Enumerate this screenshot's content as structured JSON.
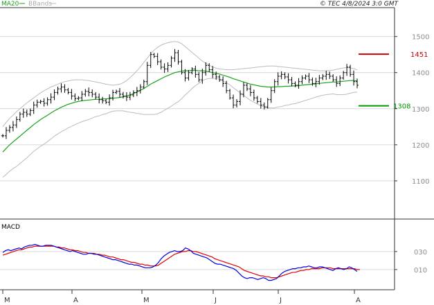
{
  "header": {
    "ma_label": "MA20",
    "bb_label": "BBands",
    "timestamp": "© TEC 4/8/2024 3:0 GMT"
  },
  "colors": {
    "ma": "#1aa21a",
    "bands": "#bbbbbb",
    "price": "#000000",
    "macd": "#0000dd",
    "signal": "#dd0000",
    "resistance": "#cc0000",
    "support": "#009900",
    "grid": "#d6d6d6",
    "frame": "#333333"
  },
  "chart_data": [
    {
      "type": "ohlc",
      "title": "",
      "ylim": [
        1000,
        1530
      ],
      "y_ticks": [
        1100,
        1200,
        1300,
        1400,
        1500
      ],
      "y_tick_labels": [
        "1100",
        "1200",
        "1300",
        "1400",
        "1500"
      ],
      "x_months": [
        "M",
        "A",
        "M",
        "J",
        "J",
        "A"
      ],
      "legend": [
        "MA20",
        "BBands"
      ],
      "reference_lines": [
        {
          "name": "resistance",
          "label": "1451",
          "value": 1451
        },
        {
          "name": "support",
          "label": "1308",
          "value": 1308
        }
      ],
      "close": [
        1225,
        1240,
        1248,
        1255,
        1270,
        1285,
        1290,
        1285,
        1295,
        1310,
        1318,
        1320,
        1315,
        1325,
        1332,
        1345,
        1355,
        1360,
        1352,
        1345,
        1335,
        1328,
        1330,
        1340,
        1348,
        1345,
        1340,
        1332,
        1325,
        1322,
        1318,
        1330,
        1345,
        1348,
        1340,
        1335,
        1332,
        1338,
        1345,
        1350,
        1360,
        1375,
        1420,
        1450,
        1445,
        1430,
        1415,
        1410,
        1420,
        1440,
        1455,
        1430,
        1400,
        1385,
        1400,
        1410,
        1395,
        1380,
        1400,
        1420,
        1408,
        1395,
        1388,
        1380,
        1370,
        1350,
        1330,
        1310,
        1320,
        1340,
        1365,
        1355,
        1345,
        1330,
        1320,
        1310,
        1305,
        1325,
        1350,
        1375,
        1390,
        1395,
        1388,
        1380,
        1370,
        1365,
        1375,
        1385,
        1390,
        1380,
        1370,
        1375,
        1385,
        1390,
        1395,
        1390,
        1380,
        1370,
        1385,
        1400,
        1415,
        1395,
        1375,
        1365
      ],
      "ma20": [
        1180,
        1190,
        1200,
        1208,
        1216,
        1224,
        1232,
        1240,
        1248,
        1256,
        1263,
        1270,
        1276,
        1282,
        1288,
        1294,
        1299,
        1304,
        1308,
        1312,
        1315,
        1318,
        1320,
        1322,
        1323,
        1324,
        1325,
        1326,
        1326,
        1327,
        1327,
        1328,
        1329,
        1330,
        1331,
        1333,
        1335,
        1338,
        1342,
        1346,
        1351,
        1356,
        1362,
        1368,
        1373,
        1378,
        1383,
        1388,
        1392,
        1396,
        1400,
        1402,
        1404,
        1405,
        1405,
        1406,
        1406,
        1405,
        1405,
        1404,
        1402,
        1400,
        1398,
        1396,
        1393,
        1390,
        1387,
        1383,
        1380,
        1377,
        1374,
        1371,
        1368,
        1366,
        1364,
        1362,
        1361,
        1360,
        1360,
        1360,
        1361,
        1361,
        1362,
        1362,
        1363,
        1363,
        1364,
        1365,
        1366,
        1367,
        1368,
        1369,
        1370,
        1371,
        1372,
        1373,
        1374,
        1374,
        1375,
        1376,
        1377,
        1378,
        1378,
        1377
      ],
      "bb_upper": [
        1250,
        1262,
        1273,
        1282,
        1292,
        1300,
        1308,
        1316,
        1323,
        1330,
        1337,
        1344,
        1350,
        1355,
        1360,
        1364,
        1368,
        1372,
        1375,
        1377,
        1379,
        1380,
        1380,
        1380,
        1379,
        1378,
        1376,
        1374,
        1372,
        1370,
        1368,
        1366,
        1365,
        1366,
        1368,
        1372,
        1378,
        1386,
        1395,
        1405,
        1416,
        1428,
        1440,
        1452,
        1462,
        1470,
        1476,
        1480,
        1483,
        1485,
        1486,
        1485,
        1480,
        1472,
        1464,
        1456,
        1448,
        1440,
        1432,
        1426,
        1420,
        1416,
        1412,
        1410,
        1409,
        1408,
        1408,
        1408,
        1409,
        1410,
        1411,
        1412,
        1413,
        1414,
        1415,
        1416,
        1417,
        1418,
        1418,
        1418,
        1417,
        1416,
        1415,
        1414,
        1413,
        1412,
        1411,
        1410,
        1409,
        1408,
        1407,
        1406,
        1405,
        1405,
        1405,
        1406,
        1407,
        1409,
        1411,
        1413,
        1414,
        1413,
        1411,
        1408
      ],
      "bb_lower": [
        1110,
        1118,
        1127,
        1134,
        1140,
        1148,
        1156,
        1164,
        1173,
        1182,
        1189,
        1196,
        1202,
        1209,
        1216,
        1224,
        1230,
        1236,
        1241,
        1247,
        1251,
        1256,
        1260,
        1264,
        1267,
        1270,
        1274,
        1278,
        1280,
        1284,
        1286,
        1290,
        1293,
        1294,
        1294,
        1294,
        1292,
        1290,
        1289,
        1287,
        1286,
        1284,
        1284,
        1284,
        1284,
        1286,
        1290,
        1296,
        1301,
        1307,
        1314,
        1319,
        1328,
        1338,
        1346,
        1356,
        1364,
        1370,
        1378,
        1382,
        1384,
        1384,
        1384,
        1382,
        1377,
        1372,
        1366,
        1358,
        1351,
        1344,
        1337,
        1330,
        1323,
        1318,
        1313,
        1308,
        1305,
        1302,
        1302,
        1302,
        1305,
        1306,
        1309,
        1310,
        1313,
        1314,
        1317,
        1320,
        1323,
        1326,
        1329,
        1332,
        1335,
        1337,
        1339,
        1340,
        1341,
        1339,
        1339,
        1339,
        1340,
        1343,
        1345,
        1346
      ]
    },
    {
      "type": "line",
      "title": "MACD",
      "ylim": [
        -5,
        42
      ],
      "y_ticks": [
        10,
        30
      ],
      "y_tick_labels": [
        "010",
        "030"
      ],
      "series": [
        {
          "name": "",
          "values": [
            29,
            31,
            32,
            31,
            32,
            33,
            34,
            33,
            35,
            36,
            37,
            37,
            38,
            37,
            36,
            36,
            37,
            37,
            37,
            36,
            35,
            34,
            33,
            32,
            31,
            30,
            31,
            30,
            29,
            28,
            27,
            27,
            28,
            28,
            27,
            27,
            26,
            25,
            24,
            23,
            22,
            21,
            21,
            20,
            19,
            18,
            17,
            16,
            16,
            15,
            15,
            14,
            13,
            12,
            12,
            12,
            13,
            15,
            18,
            22,
            25,
            27,
            29,
            30,
            31,
            30,
            30,
            31,
            34,
            33,
            31,
            28,
            27,
            26,
            25,
            24,
            23,
            21,
            19,
            17,
            16,
            16,
            15,
            14,
            13,
            12,
            11,
            9,
            6,
            3,
            1,
            0,
            1,
            1,
            0,
            -1,
            0,
            1,
            0,
            -2,
            -2,
            -1,
            0,
            3,
            6,
            8,
            9,
            10,
            11,
            11,
            12,
            12,
            13,
            13,
            14,
            13,
            12,
            12,
            13,
            13,
            12,
            11,
            10,
            9,
            11,
            12,
            11,
            10,
            11,
            13,
            12,
            10,
            8
          ]
        },
        {
          "name": "",
          "values": [
            26,
            27,
            28,
            29,
            30,
            31,
            32,
            32,
            33,
            34,
            35,
            35,
            36,
            36,
            36,
            36,
            36,
            36,
            36,
            36,
            35,
            35,
            34,
            34,
            33,
            32,
            32,
            31,
            31,
            30,
            29,
            29,
            28,
            28,
            28,
            27,
            27,
            26,
            26,
            25,
            24,
            24,
            23,
            22,
            21,
            21,
            20,
            19,
            18,
            18,
            17,
            16,
            16,
            15,
            15,
            14,
            14,
            14,
            15,
            17,
            19,
            21,
            23,
            25,
            27,
            28,
            29,
            30,
            30,
            31,
            31,
            30,
            30,
            29,
            28,
            27,
            26,
            25,
            24,
            22,
            21,
            20,
            19,
            18,
            17,
            16,
            15,
            14,
            13,
            11,
            9,
            8,
            7,
            6,
            5,
            4,
            3,
            3,
            2,
            2,
            1,
            1,
            1,
            2,
            3,
            4,
            5,
            6,
            7,
            7,
            8,
            9,
            9,
            10,
            10,
            11,
            11,
            11,
            11,
            12,
            12,
            12,
            12,
            11,
            11,
            11,
            11,
            11,
            11,
            11,
            11,
            11,
            10,
            10
          ]
        }
      ]
    }
  ]
}
